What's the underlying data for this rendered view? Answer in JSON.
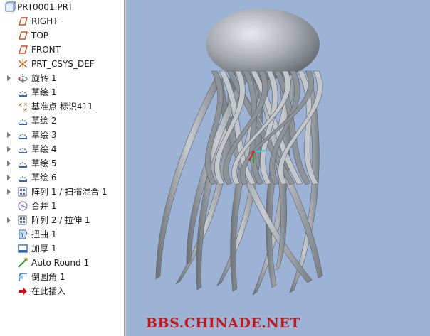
{
  "tree": {
    "root": {
      "label": "PRT0001.PRT",
      "icon": "part-icon"
    },
    "items": [
      {
        "label": "RIGHT",
        "icon": "datum-plane-icon",
        "expandable": false
      },
      {
        "label": "TOP",
        "icon": "datum-plane-icon",
        "expandable": false
      },
      {
        "label": "FRONT",
        "icon": "datum-plane-icon",
        "expandable": false
      },
      {
        "label": "PRT_CSYS_DEF",
        "icon": "csys-icon",
        "expandable": false
      },
      {
        "label": "旋转 1",
        "icon": "revolve-icon",
        "expandable": true
      },
      {
        "label": "草绘 1",
        "icon": "sketch-icon",
        "expandable": false
      },
      {
        "label": "基准点 标识411",
        "icon": "datum-point-icon",
        "expandable": false
      },
      {
        "label": "草绘 2",
        "icon": "sketch-icon",
        "expandable": false
      },
      {
        "label": "草绘 3",
        "icon": "sketch-icon",
        "expandable": true
      },
      {
        "label": "草绘 4",
        "icon": "sketch-icon",
        "expandable": true
      },
      {
        "label": "草绘 5",
        "icon": "sketch-icon",
        "expandable": true
      },
      {
        "label": "草绘 6",
        "icon": "sketch-icon",
        "expandable": true
      },
      {
        "label": "阵列 1 / 扫描混合 1",
        "icon": "pattern-icon",
        "expandable": true
      },
      {
        "label": "合并 1",
        "icon": "merge-icon",
        "expandable": false
      },
      {
        "label": "阵列 2 / 拉伸 1",
        "icon": "pattern-icon",
        "expandable": true
      },
      {
        "label": "扭曲 1",
        "icon": "warp-icon",
        "expandable": false
      },
      {
        "label": "加厚 1",
        "icon": "thicken-icon",
        "expandable": false
      },
      {
        "label": "Auto Round 1",
        "icon": "auto-round-icon",
        "expandable": false
      },
      {
        "label": "倒圆角 1",
        "icon": "round-icon",
        "expandable": false
      },
      {
        "label": "在此插入",
        "icon": "insert-here-icon",
        "expandable": false
      }
    ]
  },
  "viewport": {
    "watermark": "BBS.CHINADE.NET",
    "background": "#9cb3d6",
    "model_color": "#a9adb3"
  }
}
